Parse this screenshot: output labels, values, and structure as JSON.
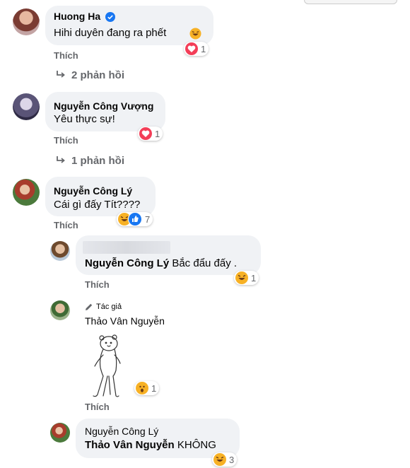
{
  "comments": [
    {
      "author": "Huong Ha",
      "text": "Hihi duyên đang ra phết",
      "like": "Thích",
      "reaction_count": "1",
      "replies": "2 phản hồi"
    },
    {
      "author": "Nguyễn Công Vượng",
      "text": "Yêu thực sự!",
      "like": "Thích",
      "reaction_count": "1",
      "replies": "1 phản hồi"
    },
    {
      "author": "Nguyễn Công Lý",
      "text": "Cái gì đấy Tít????",
      "like": "Thích",
      "reaction_count": "7"
    }
  ],
  "replies": [
    {
      "mention": "Nguyễn Công Lý",
      "text": " Bắc đẩu đấy .",
      "like": "Thích",
      "reaction_count": "1"
    },
    {
      "badge": "Tác giả",
      "author": "Thảo Vân Nguyễn",
      "like": "Thích",
      "reaction_count": "1"
    },
    {
      "author": "Nguyễn Công Lý",
      "mention": "Thảo Vân Nguyễn",
      "text": " KHÔNG",
      "reaction_count": "3"
    }
  ],
  "colors": {
    "bubble": "#f0f2f5",
    "meta": "#65676b",
    "love": "#f33e58",
    "haha": "#f7b125",
    "like": "#1877f2",
    "verified": "#1877f2"
  }
}
